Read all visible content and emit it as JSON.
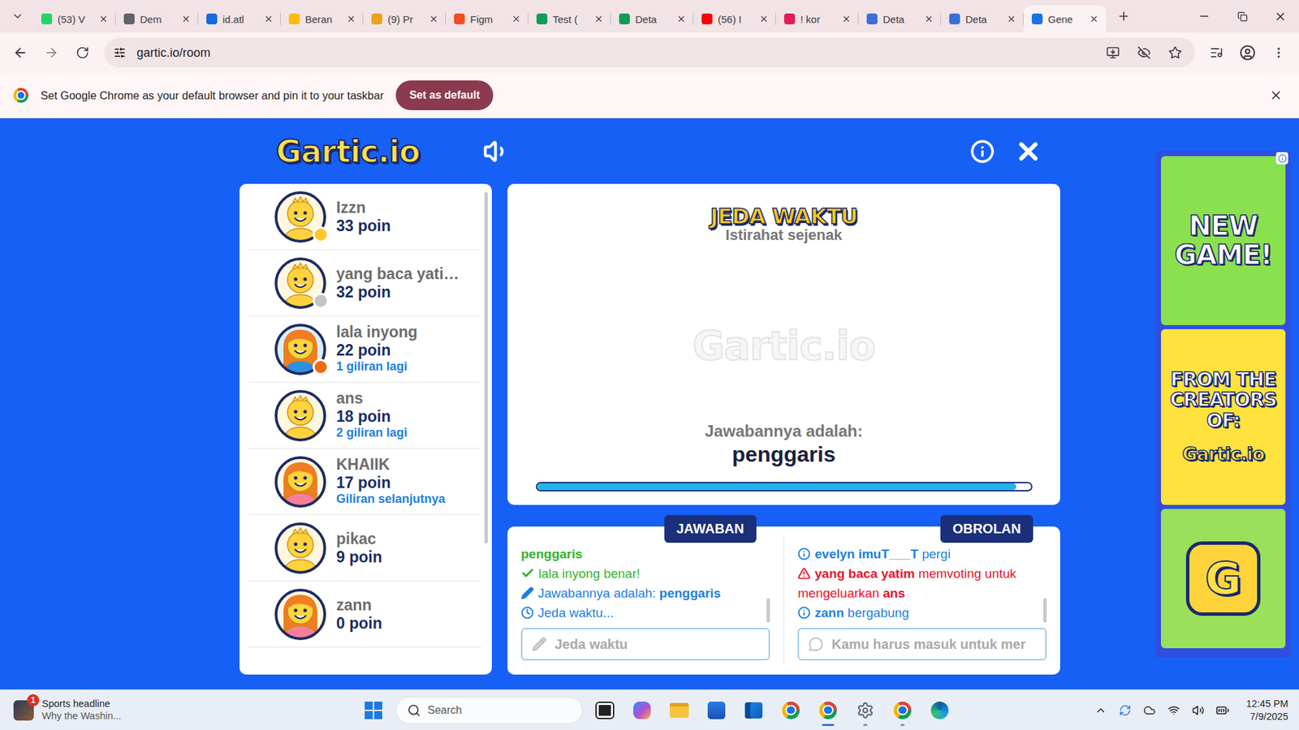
{
  "browser": {
    "tabs": [
      {
        "label": "(53) V",
        "selected": false,
        "color": "#25d366"
      },
      {
        "label": "Dem",
        "selected": false,
        "color": "#5f6368"
      },
      {
        "label": "id.atl",
        "selected": false,
        "color": "#1868db"
      },
      {
        "label": "Beran",
        "selected": false,
        "color": "#fbbc04"
      },
      {
        "label": "(9) Pr",
        "selected": false,
        "color": "#e8a317"
      },
      {
        "label": "Figm",
        "selected": false,
        "color": "#f24e1e"
      },
      {
        "label": "Test (",
        "selected": false,
        "color": "#0f9d58"
      },
      {
        "label": "Deta",
        "selected": false,
        "color": "#0f9d58"
      },
      {
        "label": "(56) I",
        "selected": false,
        "color": "#ff0000"
      },
      {
        "label": "! kor",
        "selected": false,
        "color": "#e01e5a"
      },
      {
        "label": "Deta",
        "selected": false,
        "color": "#3b6fd8"
      },
      {
        "label": "Deta",
        "selected": false,
        "color": "#3b6fd8"
      },
      {
        "label": "Gene",
        "selected": true,
        "color": "#1a73e8"
      }
    ],
    "url": "gartic.io/room",
    "infobar": {
      "message": "Set Google Chrome as your default browser and pin it to your taskbar",
      "button": "Set as default"
    }
  },
  "game": {
    "logo": "Gartic.io",
    "players": [
      {
        "name": "Izzn",
        "points": "33 poin",
        "avatar": "boy",
        "badge": "#ffc72c"
      },
      {
        "name": "yang baca yati…",
        "points": "32 poin",
        "avatar": "boy",
        "badge": "#c4c4c4"
      },
      {
        "name": "lala inyong",
        "points": "22 poin",
        "avatar": "lady",
        "badge": "#f26a13",
        "note": "1 giliran lagi"
      },
      {
        "name": "ans",
        "points": "18 poin",
        "avatar": "boy",
        "note": "2 giliran lagi"
      },
      {
        "name": "KHAIIK",
        "points": "17 poin",
        "avatar": "girl",
        "note": "Giliran selanjutnya"
      },
      {
        "name": "pikac",
        "points": "9 poin",
        "avatar": "boy"
      },
      {
        "name": "zann",
        "points": "0 poin",
        "avatar": "girl"
      }
    ],
    "round": {
      "title": "JEDA WAKTU",
      "subtitle": "Istirahat sejenak",
      "watermark": "Gartic.io",
      "answer_label": "Jawabannya adalah:",
      "answer": "penggaris",
      "level": 0.97
    },
    "answers": {
      "tab": "JAWABAN",
      "messages": [
        {
          "kind": "guess",
          "text": "penggaris"
        },
        {
          "kind": "correct",
          "user": "lala inyong",
          "text": "benar!"
        },
        {
          "kind": "reveal",
          "text": "Jawabannya adalah:",
          "value": "penggaris"
        },
        {
          "kind": "timer",
          "text": "Jeda waktu..."
        }
      ],
      "placeholder": "Jeda waktu",
      "disabled": true
    },
    "chat": {
      "tab": "OBROLAN",
      "messages": [
        {
          "kind": "info",
          "user": "evelyn imuT___T",
          "text": "pergi"
        },
        {
          "kind": "warning",
          "user": "yang baca yatim",
          "text": "memvoting untuk mengeluarkan",
          "target": "ans"
        },
        {
          "kind": "info",
          "user": "zann",
          "text": "bergabung"
        }
      ],
      "placeholder": "Kamu harus masuk untuk mer",
      "disabled": true
    }
  },
  "ad": {
    "headline": "NEW GAME!",
    "subline": "FROM THE CREATORS OF:",
    "brand": "Gartic.io",
    "app_letter": "G"
  },
  "taskbar": {
    "news": {
      "badge": "1",
      "title": "Sports headline",
      "subtitle": "Why the Washin..."
    },
    "search": "Search",
    "apps": [
      {
        "kind": "taskview",
        "running": false,
        "selected": false
      },
      {
        "kind": "copilot",
        "running": false,
        "selected": false
      },
      {
        "kind": "folder",
        "running": false,
        "selected": false
      },
      {
        "kind": "store",
        "running": false,
        "selected": false
      },
      {
        "kind": "outlook",
        "running": false,
        "selected": false
      },
      {
        "kind": "chrome",
        "running": false,
        "selected": false
      },
      {
        "kind": "chrome",
        "running": true,
        "selected": true
      },
      {
        "kind": "settings",
        "running": true,
        "selected": false
      },
      {
        "kind": "chrome",
        "running": true,
        "selected": false
      },
      {
        "kind": "edge",
        "running": false,
        "selected": false
      }
    ],
    "time": "12:45 PM",
    "date": "7/9/2025"
  }
}
